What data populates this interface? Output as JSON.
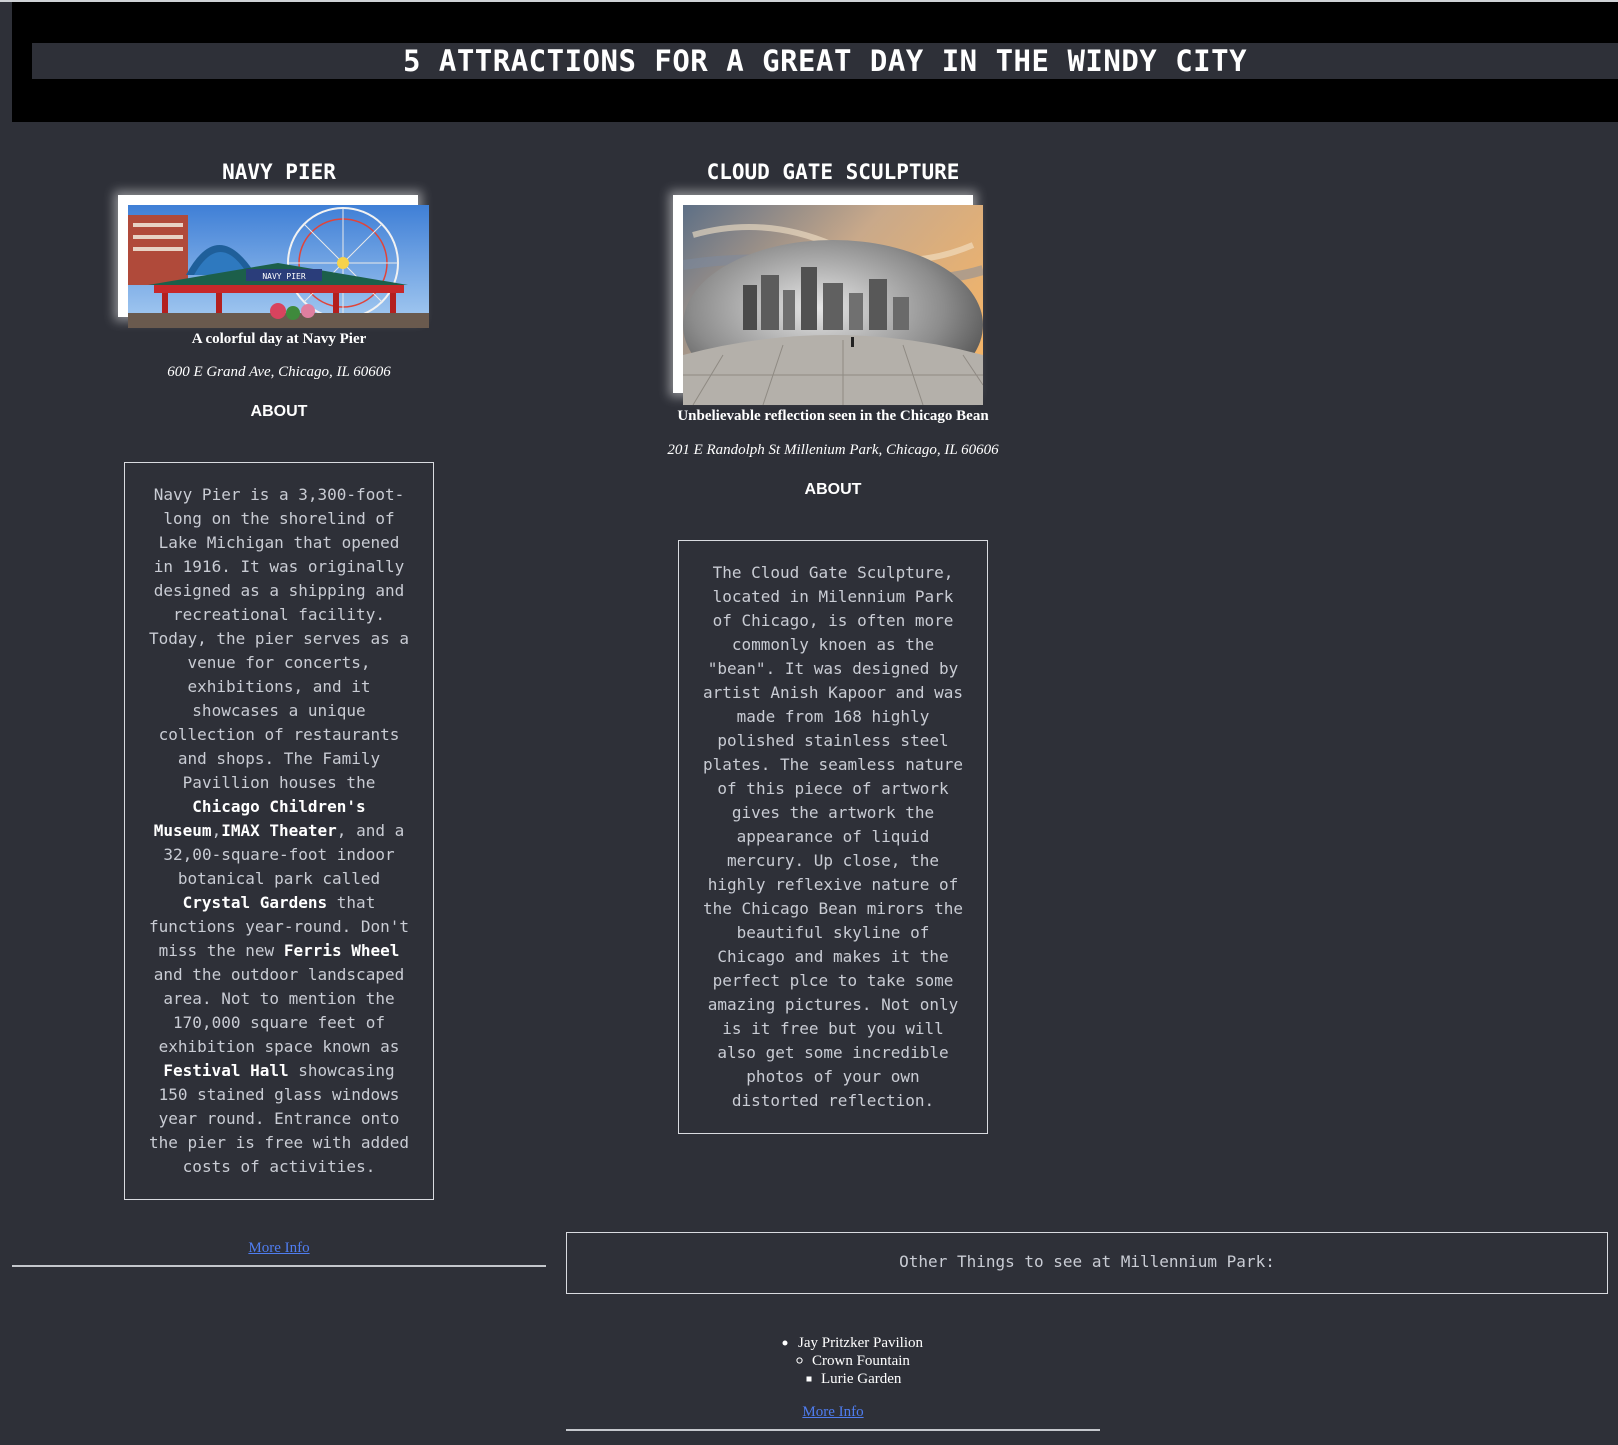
{
  "page": {
    "title": "5 ATTRACTIONS FOR A GREAT DAY IN THE WINDY CITY"
  },
  "navy_pier": {
    "title": "NAVY PIER",
    "image_alt": "Navy Pier entrance with Ferris wheel",
    "sign_text": "NAVY PIER",
    "caption": "A colorful day at Navy Pier",
    "address": "600 E Grand Ave, Chicago, IL 60606",
    "about_label": "ABOUT",
    "about": {
      "p1": "Navy Pier is a 3,300-foot-long on the shorelind of Lake Michigan that opened in 1916. It was originally designed as a shipping and recreational facility. Today, the pier serves as a venue for concerts, exhibitions, and it showcases a unique collection of restaurants and shops. The Family Pavillion houses the ",
      "b1": "Chicago Children's Museum",
      "sep1": ",",
      "b2": "IMAX Theater",
      "p2": ", and a 32,00-square-foot indoor botanical park called ",
      "b3": "Crystal Gardens",
      "p3": " that functions year-round. Don't miss the new ",
      "b4": "Ferris Wheel",
      "p4": " and the outdoor landscaped area. Not to mention the 170,000 square feet of exhibition space known as ",
      "b5": "Festival Hall",
      "p5": " showcasing 150 stained glass windows year round. Entrance onto the pier is free with added costs of activities."
    },
    "more_info": "More Info"
  },
  "cloud_gate": {
    "title": "CLOUD GATE SCULPTURE",
    "image_alt": "Cloud Gate sculpture reflecting the Chicago skyline",
    "caption": "Unbelievable reflection seen in the Chicago Bean",
    "address": "201 E Randolph St Millenium Park, Chicago, IL 60606",
    "about_label": "ABOUT",
    "about": "The Cloud Gate Sculpture, located in Milennium Park of Chicago, is often more commonly knoen as the \"bean\". It was designed by artist Anish Kapoor and was made from 168 highly polished stainless steel plates. The seamless nature of this piece of artwork gives the artwork the appearance of liquid mercury. Up close, the highly reflexive nature of the Chicago Bean mirors the beautiful skyline of Chicago and makes it the perfect plce to take some amazing pictures. Not only is it free but you will also get some incredible photos of your own distorted reflection.",
    "other_heading": "Other Things to see at Millennium Park:",
    "other_items": [
      "Jay Pritzker Pavilion",
      "Crown Fountain",
      "Lurie Garden"
    ],
    "more_info": "More Info"
  },
  "colors": {
    "background": "#2e3038",
    "header_band": "#000000",
    "link": "#4f7df0",
    "body_text": "#c9ccd4"
  }
}
